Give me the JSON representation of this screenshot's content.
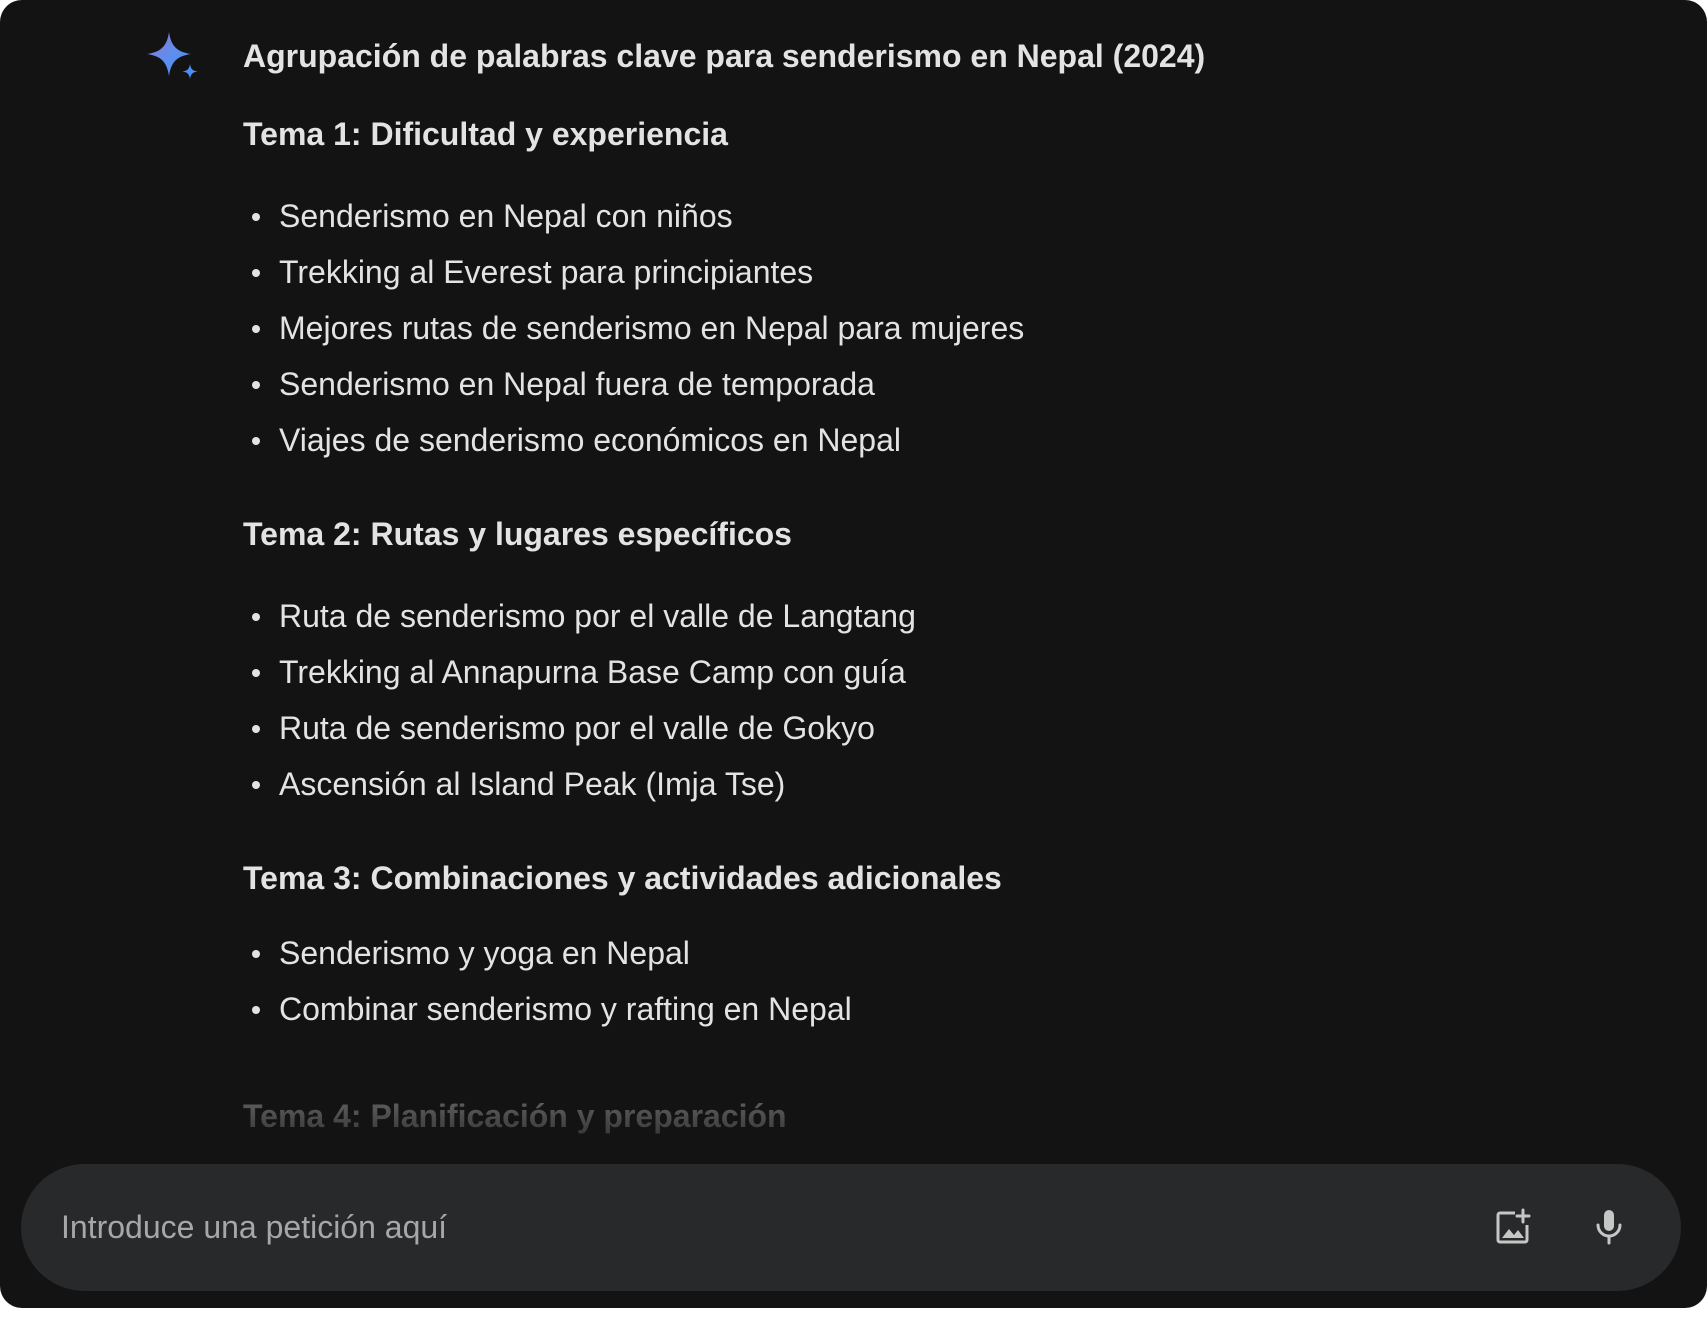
{
  "response": {
    "title": "Agrupación de palabras clave para senderismo en Nepal (2024)",
    "icon": "gemini-spark-icon",
    "sections": [
      {
        "heading": "Tema 1: Dificultad y experiencia",
        "items": [
          "Senderismo en Nepal con niños",
          "Trekking al Everest para principiantes",
          "Mejores rutas de senderismo en Nepal para mujeres",
          "Senderismo en Nepal fuera de temporada",
          "Viajes de senderismo económicos en Nepal"
        ]
      },
      {
        "heading": "Tema 2: Rutas y lugares específicos",
        "items": [
          "Ruta de senderismo por el valle de Langtang",
          "Trekking al Annapurna Base Camp con guía",
          "Ruta de senderismo por el valle de Gokyo",
          "Ascensión al Island Peak (Imja Tse)"
        ]
      },
      {
        "heading": "Tema 3: Combinaciones y actividades adicionales",
        "items": [
          "Senderismo y yoga en Nepal",
          "Combinar senderismo y rafting en Nepal"
        ]
      },
      {
        "heading": "Tema 4: Planificación y preparación",
        "items": []
      }
    ]
  },
  "input": {
    "placeholder": "Introduce una petición aquí",
    "value": "",
    "image_icon": "add-image-icon",
    "mic_icon": "microphone-icon"
  },
  "colors": {
    "background": "#131314",
    "input_background": "#28292a",
    "text": "#e3e3e3",
    "placeholder": "#a6a7a9",
    "spark_start": "#4c8df6",
    "spark_end": "#9b72cb"
  }
}
